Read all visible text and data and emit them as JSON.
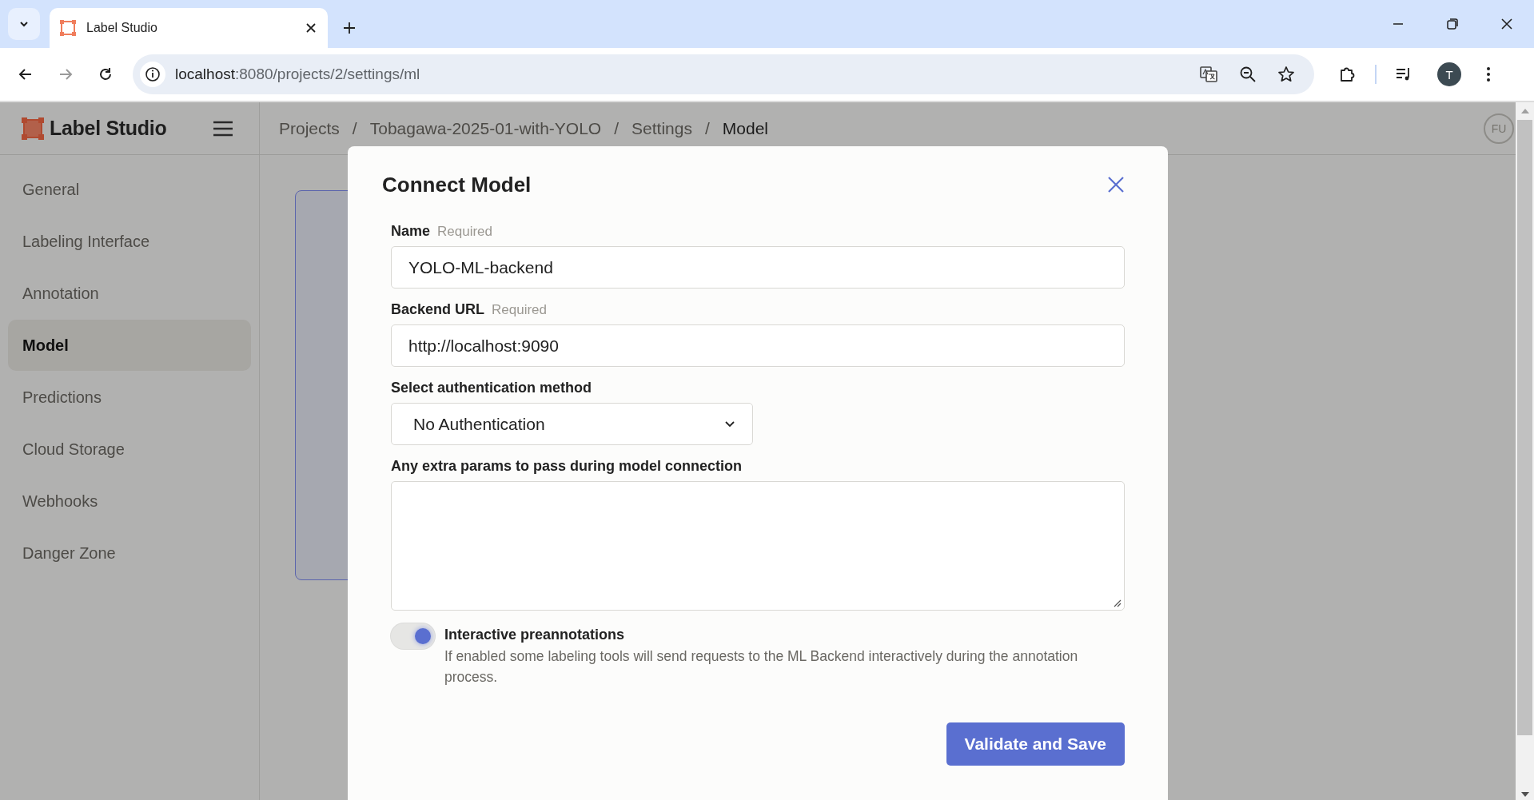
{
  "browser": {
    "tab_title": "Label Studio",
    "url_host": "localhost",
    "url_path": ":8080/projects/2/settings/ml",
    "profile_initial": "T"
  },
  "header": {
    "logo_text": "Label Studio",
    "breadcrumbs": [
      {
        "label": "Projects",
        "current": false
      },
      {
        "label": "Tobagawa-2025-01-with-YOLO",
        "current": false
      },
      {
        "label": "Settings",
        "current": false
      },
      {
        "label": "Model",
        "current": true
      }
    ],
    "separator": "/",
    "avatar": "FU"
  },
  "sidebar": {
    "items": [
      {
        "label": "General",
        "selected": false
      },
      {
        "label": "Labeling Interface",
        "selected": false
      },
      {
        "label": "Annotation",
        "selected": false
      },
      {
        "label": "Model",
        "selected": true
      },
      {
        "label": "Predictions",
        "selected": false
      },
      {
        "label": "Cloud Storage",
        "selected": false
      },
      {
        "label": "Webhooks",
        "selected": false
      },
      {
        "label": "Danger Zone",
        "selected": false
      }
    ]
  },
  "modal": {
    "title": "Connect Model",
    "fields": [
      {
        "kind": "input",
        "label": "Name",
        "hint": "Required",
        "value": "YOLO-ML-backend"
      },
      {
        "kind": "input",
        "label": "Backend URL",
        "hint": "Required",
        "value": "http://localhost:9090"
      },
      {
        "kind": "select",
        "label": "Select authentication method",
        "value": "No Authentication"
      },
      {
        "kind": "textarea",
        "label": "Any extra params to pass during model connection"
      }
    ],
    "toggle": {
      "label": "Interactive preannotations",
      "description": "If enabled some labeling tools will send requests to the ML Backend interactively during the annotation process.",
      "on": true
    },
    "button": "Validate and Save"
  }
}
